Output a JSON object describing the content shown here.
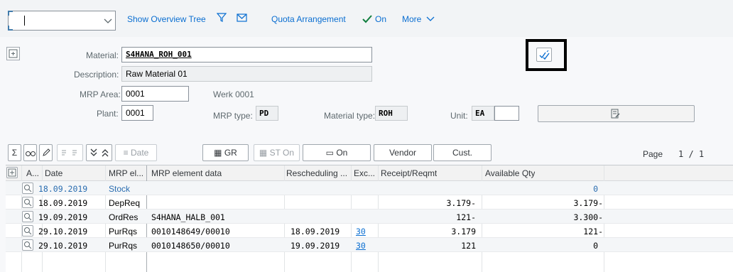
{
  "toolbar": {
    "dropdown_value": "",
    "show_overview_tree": "Show Overview Tree",
    "quota_arrangement": "Quota Arrangement",
    "on_label": "On",
    "more_label": "More"
  },
  "header": {
    "material_label": "Material:",
    "material_value": "S4HANA_ROH_001",
    "description_label": "Description:",
    "description_value": "Raw Material 01",
    "mrp_area_label": "MRP Area:",
    "mrp_area_value": "0001",
    "mrp_area_text": "Werk 0001",
    "plant_label": "Plant:",
    "plant_value": "0001",
    "mrp_type_label": "MRP type:",
    "mrp_type_value": "PD",
    "material_type_label": "Material type:",
    "material_type_value": "ROH",
    "unit_label": "Unit:",
    "unit_value": "EA",
    "unit_extra": ""
  },
  "grid_toolbar": {
    "date": "Date",
    "gr": "GR",
    "st_on": "ST On",
    "on": "On",
    "vendor": "Vendor",
    "cust": "Cust.",
    "page_label": "Page",
    "page_info": "1  /  1"
  },
  "table": {
    "columns": [
      "A...",
      "Date",
      "MRP el...",
      "MRP element data",
      "Rescheduling ...",
      "Exc...",
      "Receipt/Reqmt",
      "Available Qty"
    ],
    "rows": [
      {
        "date": "18.09.2019",
        "mrp_el": "Stock",
        "data": "",
        "resched": "",
        "exc": "",
        "receipt": "",
        "avail": "0"
      },
      {
        "date": "18.09.2019",
        "mrp_el": "DepReq",
        "data": "",
        "resched": "",
        "exc": "",
        "receipt": "3.179-",
        "avail": "3.179-"
      },
      {
        "date": "19.09.2019",
        "mrp_el": "OrdRes",
        "data": "S4HANA_HALB_001",
        "resched": "",
        "exc": "",
        "receipt": "121-",
        "avail": "3.300-"
      },
      {
        "date": "29.10.2019",
        "mrp_el": "PurRqs",
        "data": "0010148649/00010",
        "resched": "18.09.2019",
        "exc": "30",
        "receipt": "3.179",
        "avail": "121-"
      },
      {
        "date": "29.10.2019",
        "mrp_el": "PurRqs",
        "data": "0010148650/00010",
        "resched": "19.09.2019",
        "exc": "30",
        "receipt": "121",
        "avail": "0"
      }
    ]
  },
  "colors": {
    "link": "#0a6ed1",
    "highlight_border": "#000000"
  }
}
